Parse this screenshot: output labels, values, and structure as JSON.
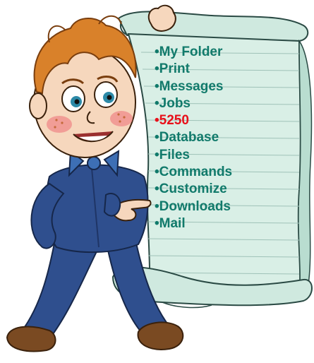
{
  "menu": {
    "items": [
      {
        "label": "My Folder",
        "color": "#117a6b"
      },
      {
        "label": "Print",
        "color": "#117a6b"
      },
      {
        "label": "Messages",
        "color": "#117a6b"
      },
      {
        "label": "Jobs",
        "color": "#117a6b"
      },
      {
        "label": "5250",
        "color": "#e8101a"
      },
      {
        "label": "Database",
        "color": "#117a6b"
      },
      {
        "label": "Files",
        "color": "#117a6b"
      },
      {
        "label": "Commands",
        "color": "#117a6b"
      },
      {
        "label": "Customize",
        "color": "#117a6b"
      },
      {
        "label": "Downloads",
        "color": "#117a6b"
      },
      {
        "label": "Mail",
        "color": "#117a6b"
      }
    ],
    "bullet": "•"
  },
  "illustration": {
    "subject": "cartoon-boy-holding-scroll",
    "colors": {
      "scroll_paper": "#d9efe6",
      "scroll_shade": "#b9ddd0",
      "scroll_lines": "#9fc2b8",
      "suit": "#2f4f8e",
      "suit_dark": "#1f3566",
      "hair": "#d9812a",
      "skin": "#f6d7bd",
      "cheek": "#ef8a8a",
      "bowtie": "#3d6fb5",
      "shoe": "#7a4a22"
    }
  }
}
